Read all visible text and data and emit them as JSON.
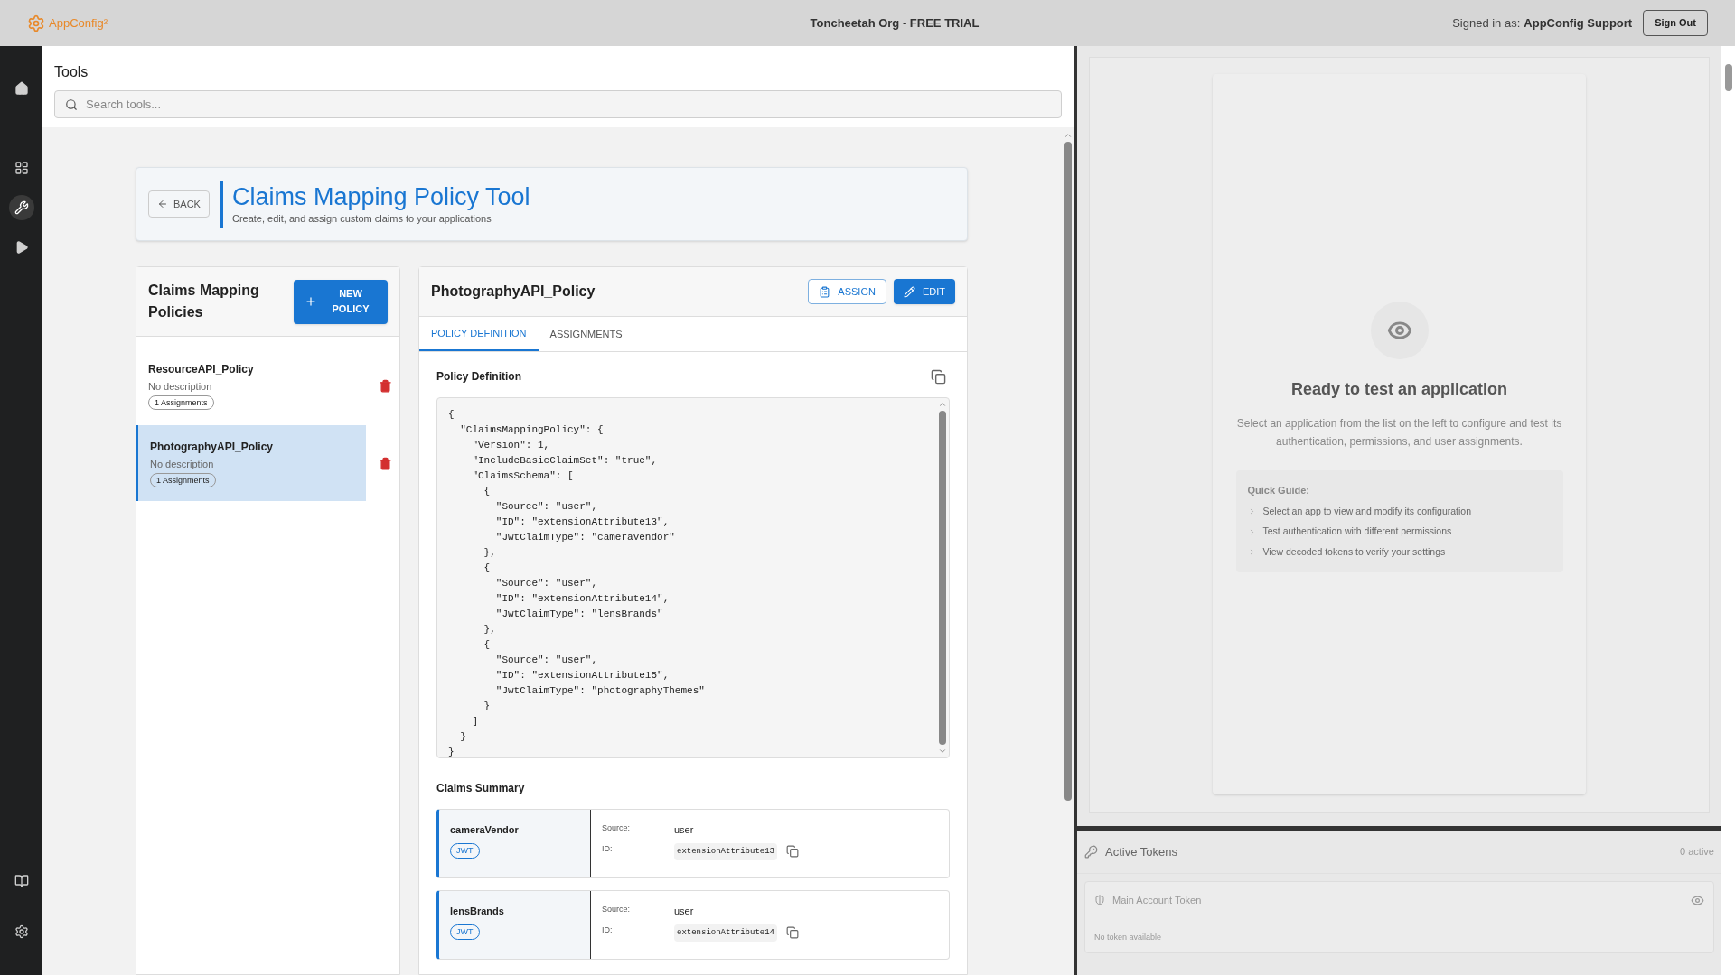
{
  "top_bar": {
    "logo": "AppConfig²",
    "org_title": "Toncheetah Org - FREE TRIAL",
    "signed_in_label": "Signed in as:",
    "signed_in_user": "AppConfig Support",
    "sign_out": "Sign Out"
  },
  "nav": {
    "top": [
      {
        "kind": "home",
        "selected": false
      },
      {
        "kind": "apps",
        "selected": false
      },
      {
        "kind": "tools",
        "selected": true
      },
      {
        "kind": "run",
        "selected": false
      }
    ],
    "bottom": [
      {
        "kind": "docs",
        "selected": false
      },
      {
        "kind": "settings",
        "selected": false
      }
    ]
  },
  "tools": {
    "title": "Tools",
    "search": {
      "placeholder": "Search tools..."
    }
  },
  "header": {
    "back": "BACK",
    "title": "Claims Mapping Policy Tool",
    "subtitle": "Create, edit, and assign custom claims to your applications"
  },
  "policies": {
    "title": "Claims Mapping Policies",
    "new_button": "NEW POLICY",
    "items": [
      {
        "name": "ResourceAPI_Policy",
        "description": "No description",
        "badge": "1 Assignments",
        "selected": false
      },
      {
        "name": "PhotographyAPI_Policy",
        "description": "No description",
        "badge": "1 Assignments",
        "selected": true
      }
    ]
  },
  "detail": {
    "title": "PhotographyAPI_Policy",
    "assign": "ASSIGN",
    "edit": "EDIT",
    "tabs": [
      {
        "label": "POLICY DEFINITION",
        "selected": true
      },
      {
        "label": "ASSIGNMENTS",
        "selected": false
      }
    ],
    "definition_title": "Policy Definition",
    "code_lines": [
      "{",
      "  \"ClaimsMappingPolicy\": {",
      "    \"Version\": 1,",
      "    \"IncludeBasicClaimSet\": \"true\",",
      "    \"ClaimsSchema\": [",
      "      {",
      "        \"Source\": \"user\",",
      "        \"ID\": \"extensionAttribute13\",",
      "        \"JwtClaimType\": \"cameraVendor\"",
      "      },",
      "      {",
      "        \"Source\": \"user\",",
      "        \"ID\": \"extensionAttribute14\",",
      "        \"JwtClaimType\": \"lensBrands\"",
      "      },",
      "      {",
      "        \"Source\": \"user\",",
      "        \"ID\": \"extensionAttribute15\",",
      "        \"JwtClaimType\": \"photographyThemes\"",
      "      }",
      "    ]",
      "  }",
      "}"
    ],
    "summary_title": "Claims Summary",
    "claims": [
      {
        "name": "cameraVendor",
        "badge": "JWT",
        "source_label": "Source:",
        "source": "user",
        "id_label": "ID:",
        "id": "extensionAttribute13"
      },
      {
        "name": "lensBrands",
        "badge": "JWT",
        "source_label": "Source:",
        "source": "user",
        "id_label": "ID:",
        "id": "extensionAttribute14"
      }
    ]
  },
  "tester": {
    "title": "Ready to test an application",
    "text": "Select an application from the list on the left to configure and test its authentication, permissions, and user assignments.",
    "guide_title": "Quick Guide:",
    "guide_items": [
      "Select an app to view and modify its configuration",
      "Test authentication with different permissions",
      "View decoded tokens to verify your settings"
    ]
  },
  "tokens": {
    "title": "Active Tokens",
    "count": "0 active",
    "items": [
      {
        "name": "Main Account Token",
        "status": "No token available"
      }
    ]
  }
}
